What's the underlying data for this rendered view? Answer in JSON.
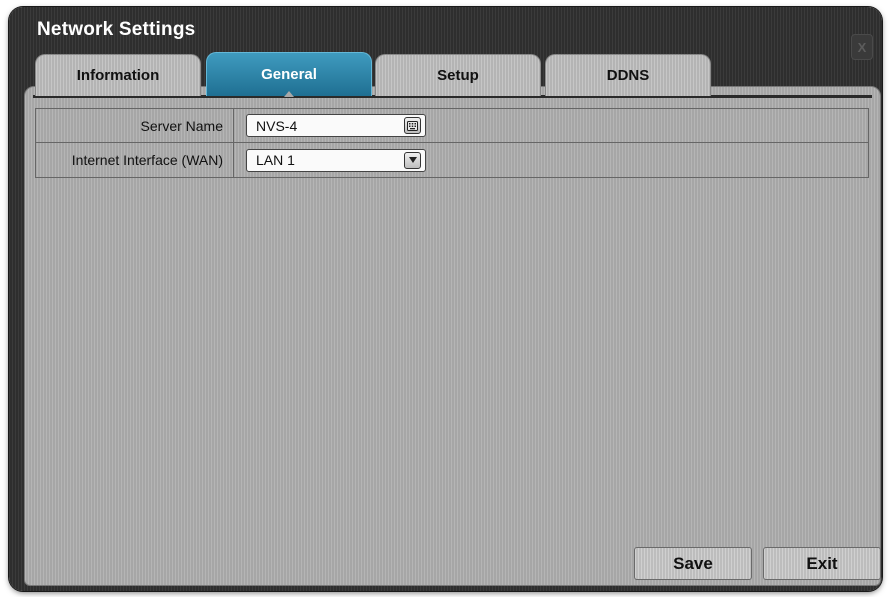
{
  "window": {
    "title": "Network Settings",
    "close_label": "X"
  },
  "tabs": [
    {
      "label": "Information",
      "active": false
    },
    {
      "label": "General",
      "active": true
    },
    {
      "label": "Setup",
      "active": false
    },
    {
      "label": "DDNS",
      "active": false
    }
  ],
  "form": {
    "server_name": {
      "label": "Server Name",
      "value": "NVS-4",
      "icon": "keyboard-icon"
    },
    "internet_interface": {
      "label": "Internet Interface (WAN)",
      "value": "LAN 1",
      "icon": "chevron-down-icon"
    }
  },
  "buttons": {
    "save": "Save",
    "exit": "Exit"
  },
  "colors": {
    "active_tab": "#2a86ab",
    "window_bg": "#333333",
    "panel_bg": "#b0b0b0"
  }
}
